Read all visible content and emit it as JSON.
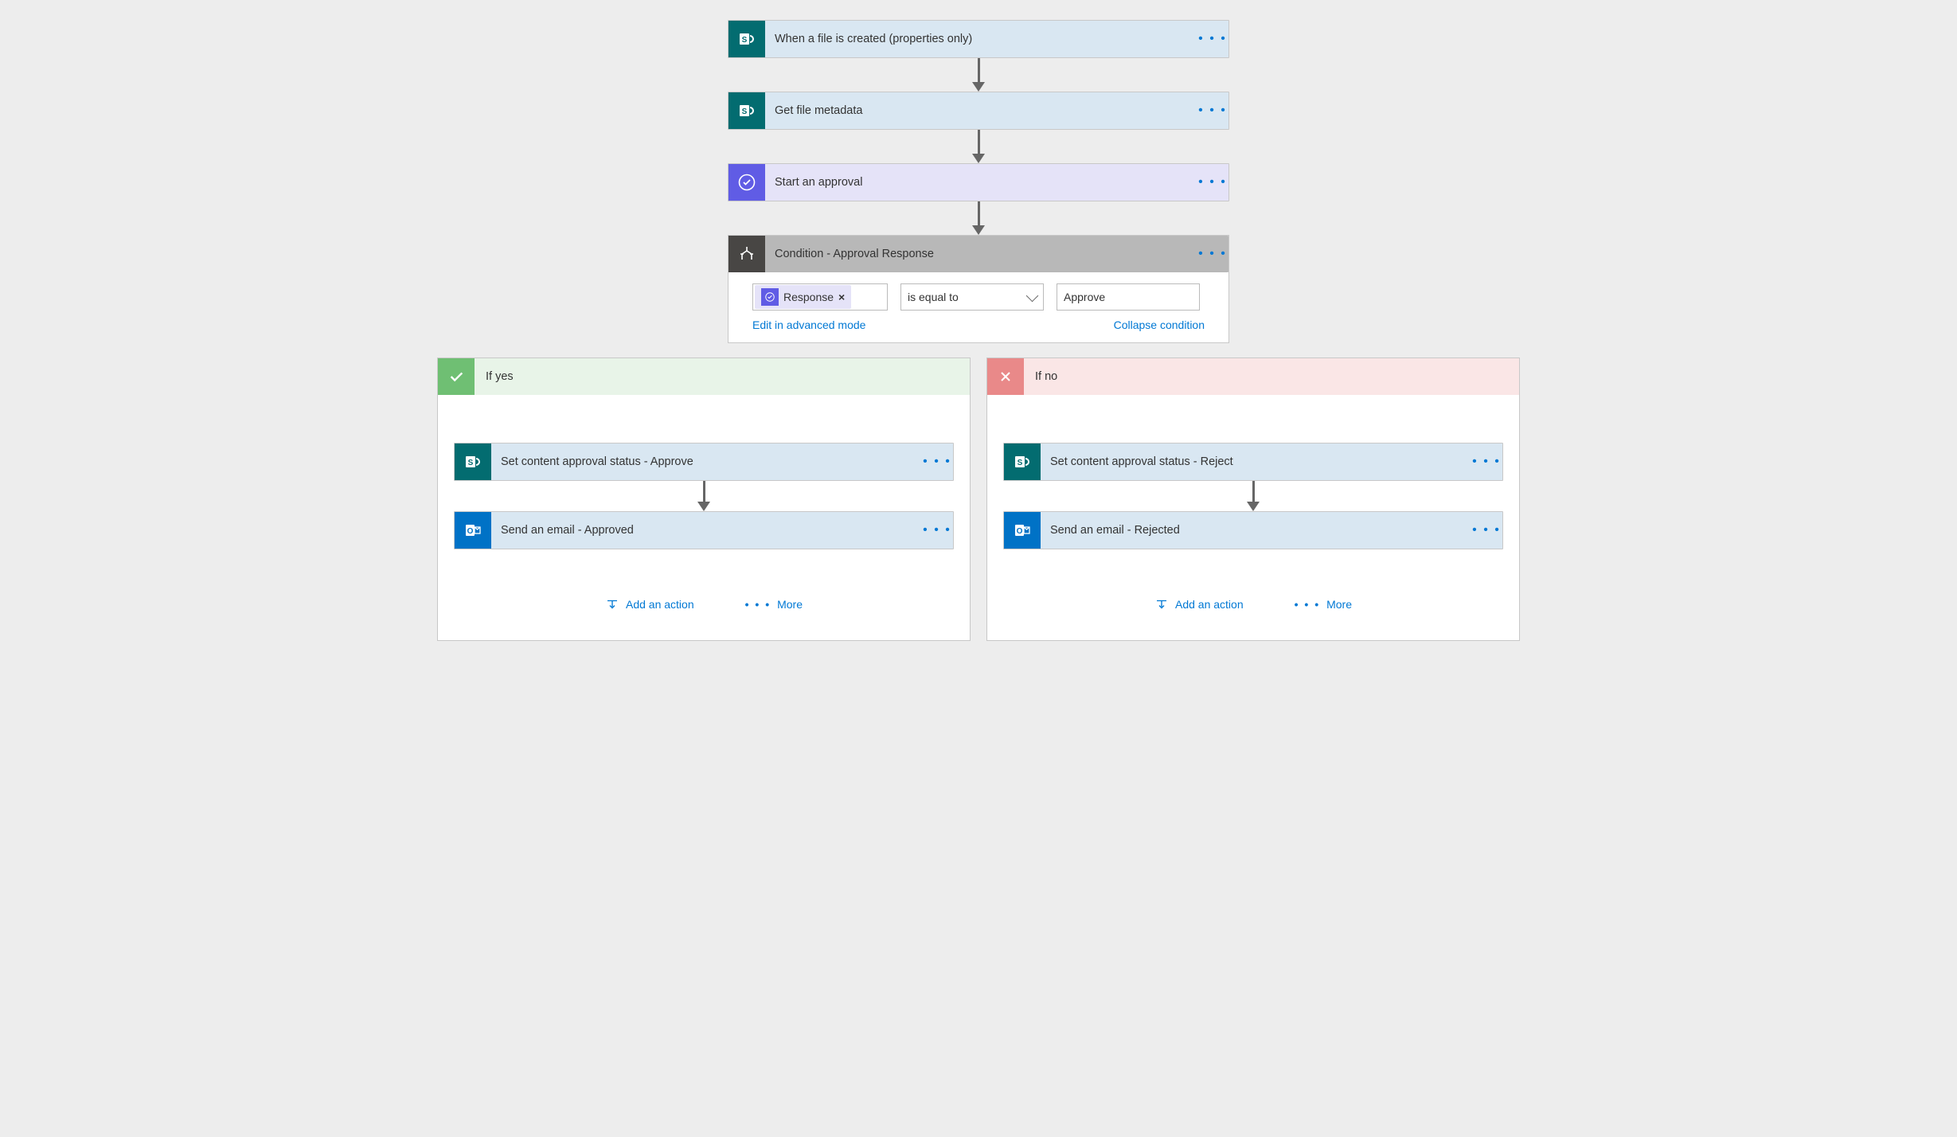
{
  "steps": {
    "s1": "When a file is created (properties only)",
    "s2": "Get file metadata",
    "s3": "Start an approval",
    "s4": "Condition - Approval Response"
  },
  "condition": {
    "token_label": "Response",
    "operator": "is equal to",
    "value": "Approve",
    "edit_link": "Edit in advanced mode",
    "collapse_link": "Collapse condition"
  },
  "branches": {
    "yes": {
      "title": "If yes",
      "step1": "Set content approval status - Approve",
      "step2": "Send an email - Approved"
    },
    "no": {
      "title": "If no",
      "step1": "Set content approval status - Reject",
      "step2": "Send an email - Rejected"
    },
    "add_action": "Add an action",
    "more": "More"
  }
}
